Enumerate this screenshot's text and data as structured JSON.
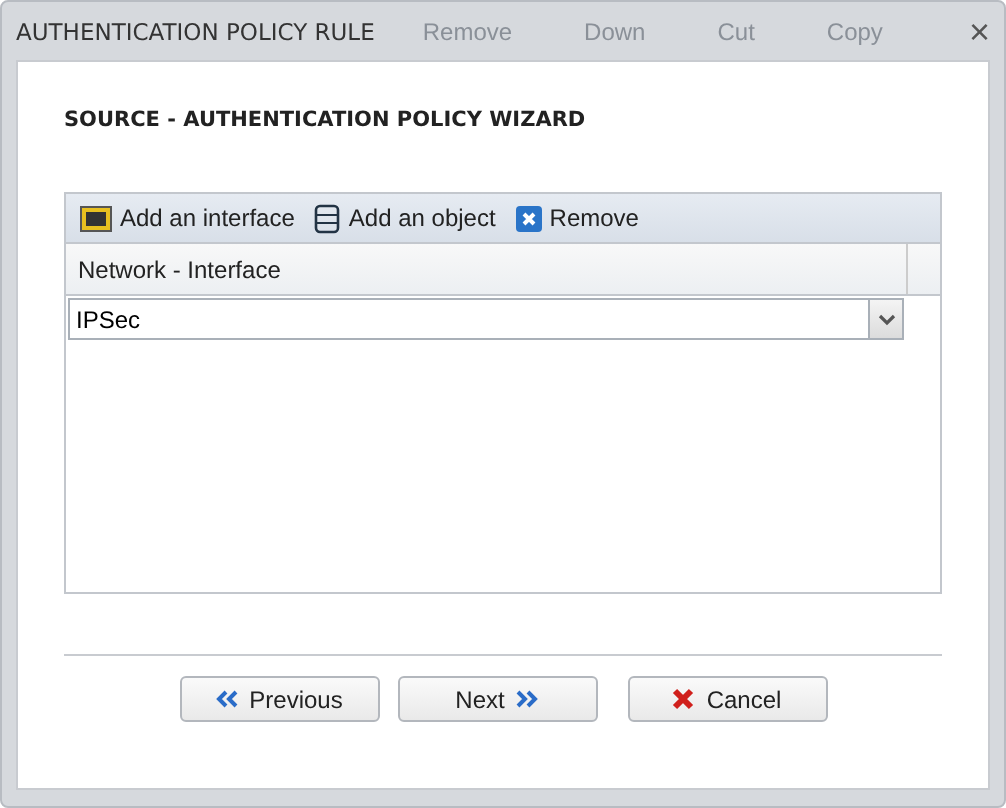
{
  "window": {
    "title": "AUTHENTICATION POLICY RULE",
    "close": "×"
  },
  "background_toolbar": [
    "Remove",
    "Down",
    "Cut",
    "Copy"
  ],
  "heading": "SOURCE - AUTHENTICATION POLICY WIZARD",
  "toolbar": [
    {
      "kind": "interface",
      "label": "Add an interface"
    },
    {
      "kind": "object",
      "label": "Add an object"
    },
    {
      "kind": "remove",
      "label": "Remove"
    }
  ],
  "table": {
    "columns": [
      "Network - Interface"
    ],
    "editor": {
      "value": "IPSec"
    }
  },
  "buttons": [
    {
      "kind": "previous",
      "label": "Previous"
    },
    {
      "kind": "next",
      "label": "Next"
    },
    {
      "kind": "cancel",
      "label": "Cancel"
    }
  ]
}
